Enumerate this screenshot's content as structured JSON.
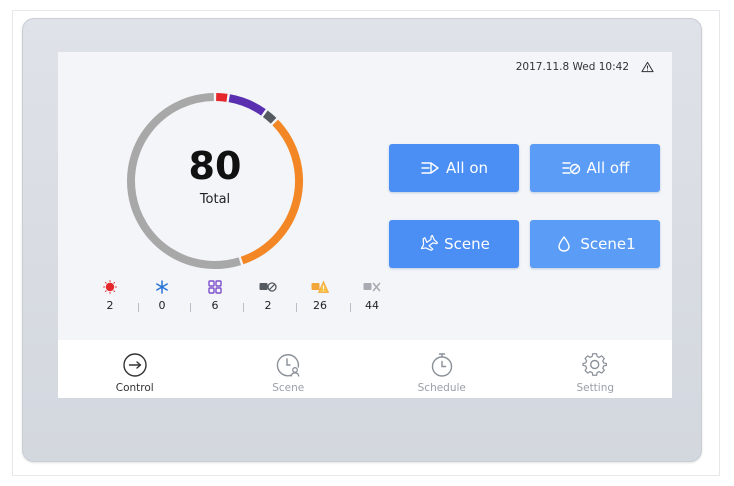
{
  "status": {
    "datetime": "2017.11.8 Wed 10:42",
    "alert_icon": "warning-triangle-icon"
  },
  "summary": {
    "total": "80",
    "total_label": "Total"
  },
  "ring": {
    "segments": [
      {
        "status": "fault",
        "value": 2,
        "color": "#e5262a"
      },
      {
        "status": "group",
        "value": 6,
        "color": "#5a2fb0"
      },
      {
        "status": "offline",
        "value": 2,
        "color": "#555a60"
      },
      {
        "status": "warning",
        "value": 26,
        "color": "#f38726"
      },
      {
        "status": "disconnected",
        "value": 44,
        "color": "#a8a8a8"
      }
    ]
  },
  "stats": [
    {
      "icon": "alarm-icon",
      "color": "#e5262a",
      "value": "2"
    },
    {
      "icon": "snowflake-icon",
      "color": "#2a74d8",
      "value": "0"
    },
    {
      "icon": "grid-icon",
      "color": "#7d4fcb",
      "value": "6"
    },
    {
      "icon": "device-off-icon",
      "color": "#555a60",
      "value": "2"
    },
    {
      "icon": "device-warning-icon",
      "color": "#f2a63a",
      "value": "26"
    },
    {
      "icon": "device-disconnected-icon",
      "color": "#a8acb2",
      "value": "44"
    }
  ],
  "quick_actions": {
    "all_on": "All on",
    "all_off": "All off",
    "scene": "Scene",
    "scene1": "Scene1"
  },
  "nav": [
    {
      "label": "Control",
      "icon": "control-icon",
      "active": true
    },
    {
      "label": "Scene",
      "icon": "scene-icon",
      "active": false
    },
    {
      "label": "Schedule",
      "icon": "timer-icon",
      "active": false
    },
    {
      "label": "Setting",
      "icon": "gear-icon",
      "active": false
    }
  ],
  "colors": {
    "accent": "#4b8ef4",
    "nav_active": "#333333",
    "nav_inactive": "#9aa0a8"
  }
}
